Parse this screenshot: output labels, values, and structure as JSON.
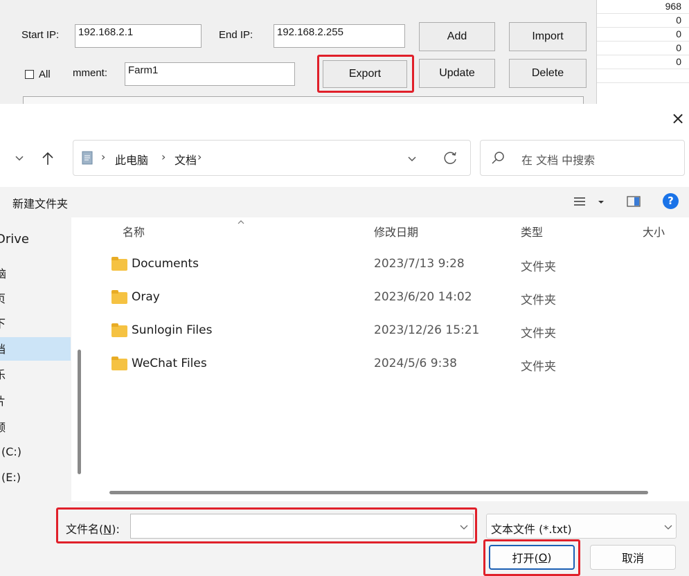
{
  "bg_app": {
    "start_ip_label": "Start IP:",
    "start_ip_value": "192.168.2.1",
    "end_ip_label": "End IP:",
    "end_ip_value": "192.168.2.255",
    "all_label": "All",
    "comment_label": "mment:",
    "comment_value": "Farm1",
    "buttons": {
      "add": "Add",
      "import": "Import",
      "export": "Export",
      "update": "Update",
      "delete": "Delete"
    },
    "grid_values": [
      "968",
      "0",
      "0",
      "0",
      "0"
    ]
  },
  "dialog": {
    "close_glyph": "×",
    "breadcrumb": [
      "此电脑",
      "文档"
    ],
    "search_placeholder": "在 文档 中搜索",
    "new_folder": "新建文件夹",
    "help_glyph": "?",
    "columns": {
      "name": "名称",
      "modified": "修改日期",
      "type": "类型",
      "size": "大小"
    },
    "files": [
      {
        "name": "Documents",
        "modified": "2023/7/13 9:28",
        "type": "文件夹"
      },
      {
        "name": "Oray",
        "modified": "2023/6/20 14:02",
        "type": "文件夹"
      },
      {
        "name": "Sunlogin Files",
        "modified": "2023/12/26 15:21",
        "type": "文件夹"
      },
      {
        "name": "WeChat Files",
        "modified": "2024/5/6 9:38",
        "type": "文件夹"
      }
    ],
    "nav_items": [
      "Drive",
      "脑",
      "页",
      "下",
      "档",
      "乐",
      "片",
      "频",
      "(C:)",
      "(E:)"
    ],
    "filename_label_pre": "文件名(",
    "filename_label_key": "N",
    "filename_label_post": "):",
    "filename_value": "",
    "filetype_value": "文本文件 (*.txt)",
    "open_pre": "打开(",
    "open_key": "O",
    "open_post": ")",
    "cancel": "取消"
  },
  "colors": {
    "highlight": "#e0202a",
    "nav_selected": "#cce4f7",
    "help_blue": "#1a73e8",
    "folder": "#f5c242"
  }
}
